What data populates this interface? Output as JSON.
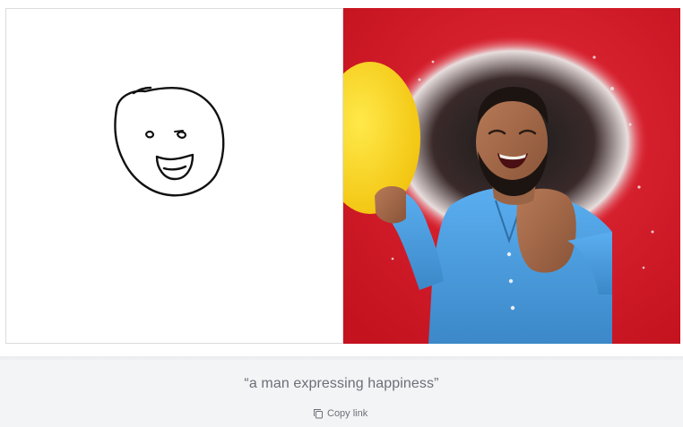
{
  "sketch": {
    "stroke_color": "#111111",
    "background": "#ffffff"
  },
  "photo": {
    "background_color": "#d31a2b",
    "balloon_color": "#f7d21a",
    "shirt_color": "#4a9bd8"
  },
  "caption": {
    "text": "“a man expressing happiness”"
  },
  "actions": {
    "copy_link_label": "Copy link",
    "copy_link_icon": "copy-icon"
  }
}
